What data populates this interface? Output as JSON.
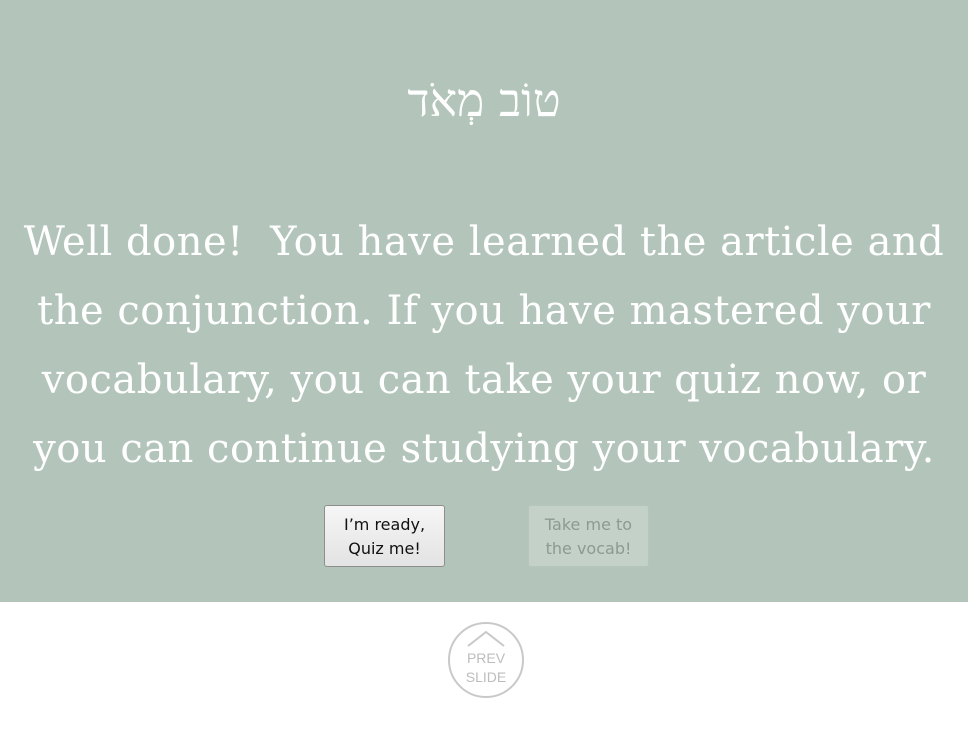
{
  "slide": {
    "hebrew_title": "טוֹב מְאֹד",
    "message_lines": [
      "Well done!  You have learned the article and",
      "the conjunction. If you have mastered your",
      "vocabulary, you can take your quiz now, or",
      "you can continue studying your vocabulary."
    ],
    "buttons": {
      "quiz": {
        "line1": "I’m ready,",
        "line2": "Quiz me!"
      },
      "vocab": {
        "line1": "Take me to",
        "line2": "the vocab!"
      }
    }
  },
  "nav": {
    "prev_line1": "PREV",
    "prev_line2": "SLIDE",
    "prev_icon": "home-icon"
  },
  "colors": {
    "slide_background": "#b3c5bb",
    "text": "#ffffff"
  }
}
